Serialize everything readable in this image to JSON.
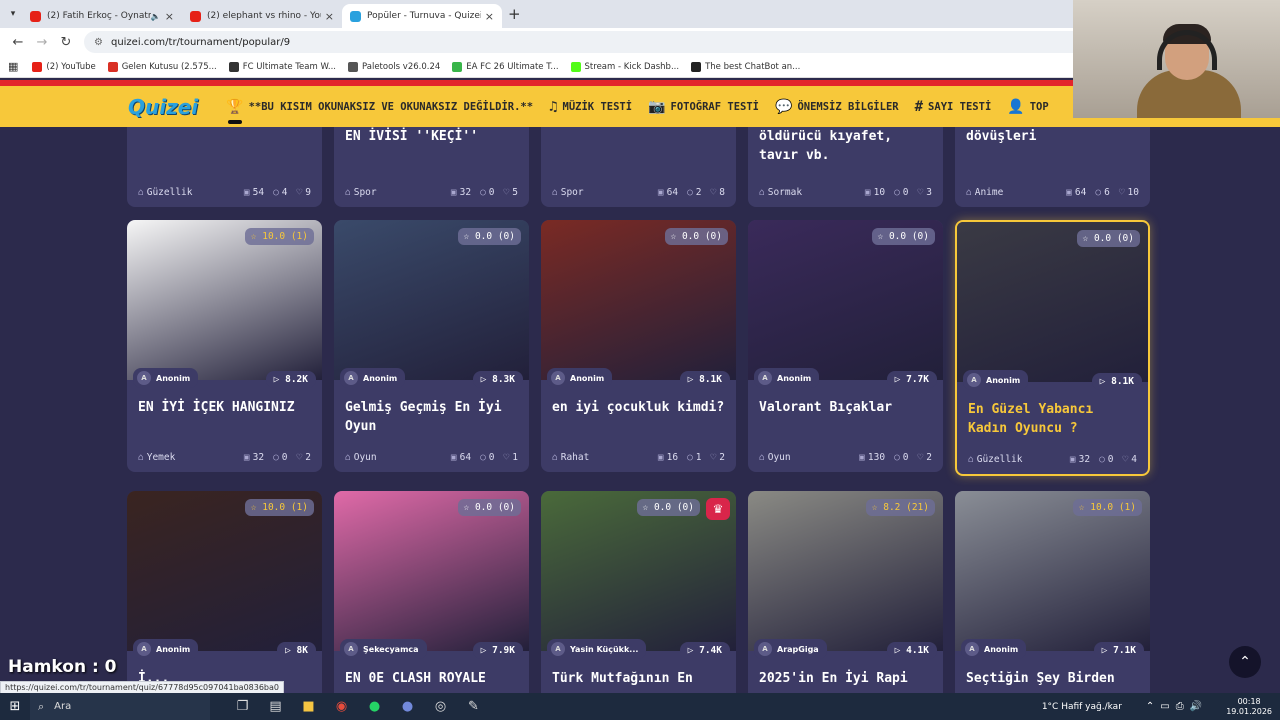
{
  "browser": {
    "tabs": [
      {
        "title": "(2) Fatih Erkoç - Oynatmay",
        "color": "#e62117",
        "muted": true,
        "active": false
      },
      {
        "title": "(2) elephant vs rhino - YouTube",
        "color": "#e62117",
        "muted": false,
        "active": false
      },
      {
        "title": "Popüler - Turnuva - Quizei",
        "color": "#2aa1de",
        "muted": false,
        "active": true
      }
    ],
    "new_tab": "+",
    "url": "quizei.com/tr/tournament/popular/9",
    "bookmarks": [
      {
        "label": "(2) YouTube",
        "color": "#e62117"
      },
      {
        "label": "Gelen Kutusu (2.575...",
        "color": "#d93025"
      },
      {
        "label": "FC Ultimate Team W...",
        "color": "#333333"
      },
      {
        "label": "Paletools v26.0.24",
        "color": "#555555"
      },
      {
        "label": "EA FC 26 Ultimate T...",
        "color": "#39b54a"
      },
      {
        "label": "Stream - Kick Dashb...",
        "color": "#53fc18"
      },
      {
        "label": "The best ChatBot an...",
        "color": "#222222"
      }
    ]
  },
  "site": {
    "logo": "Quizei",
    "nav": [
      {
        "label": "**BU KISIM OKUNAKSIZ VE OKUNAKSIZ DEĞİLDİR.**",
        "icon": "trophy-icon",
        "glyph": "🏆"
      },
      {
        "label": "MÜZİK TESTİ",
        "icon": "music-icon",
        "glyph": "♫"
      },
      {
        "label": "FOTOĞRAF TESTİ",
        "icon": "camera-icon",
        "glyph": "📷"
      },
      {
        "label": "ÖNEMSİZ BİLGİLER",
        "icon": "speech-bubble-icon",
        "glyph": "💬"
      },
      {
        "label": "SAYI TESTİ",
        "icon": "hashtag-icon",
        "glyph": "#"
      },
      {
        "label": "TOP",
        "icon": "user-icon",
        "glyph": "👤"
      }
    ]
  },
  "top_row": [
    {
      "title": "",
      "category": "Güzellik",
      "questions": "54",
      "comments": "4",
      "likes": "9"
    },
    {
      "title": "EN İVİSİ ''KEÇİ''",
      "category": "Spor",
      "questions": "32",
      "comments": "0",
      "likes": "5"
    },
    {
      "title": "",
      "category": "Spor",
      "questions": "64",
      "comments": "2",
      "likes": "8"
    },
    {
      "title": "öldürücü kıyafet, tavır vb.",
      "category": "Sormak",
      "questions": "10",
      "comments": "0",
      "likes": "3"
    },
    {
      "title": "dövüşleri",
      "category": "Anime",
      "questions": "64",
      "comments": "6",
      "likes": "10"
    }
  ],
  "row2": [
    {
      "rating": "10.0 (1)",
      "gold": true,
      "author": "Anonim",
      "plays": "8.2K",
      "title": "EN İYİ İÇEK HANGINIZ",
      "category": "Yemek",
      "questions": "32",
      "comments": "0",
      "likes": "2",
      "highlight": false
    },
    {
      "rating": "0.0 (0)",
      "gold": false,
      "author": "Anonim",
      "plays": "8.3K",
      "title": "Gelmiş Geçmiş En İyi Oyun",
      "category": "Oyun",
      "questions": "64",
      "comments": "0",
      "likes": "1",
      "highlight": false
    },
    {
      "rating": "0.0 (0)",
      "gold": false,
      "author": "Anonim",
      "plays": "8.1K",
      "title": "en iyi çocukluk kimdi?",
      "category": "Rahat",
      "questions": "16",
      "comments": "1",
      "likes": "2",
      "highlight": false
    },
    {
      "rating": "0.0 (0)",
      "gold": false,
      "author": "Anonim",
      "plays": "7.7K",
      "title": "Valorant Bıçaklar",
      "category": "Oyun",
      "questions": "130",
      "comments": "0",
      "likes": "2",
      "highlight": false
    },
    {
      "rating": "0.0 (0)",
      "gold": false,
      "author": "Anonim",
      "plays": "8.1K",
      "title": "En Güzel Yabancı Kadın Oyuncu ?",
      "category": "Güzellik",
      "questions": "32",
      "comments": "0",
      "likes": "4",
      "highlight": true
    }
  ],
  "row3": [
    {
      "rating": "10.0 (1)",
      "gold": true,
      "author": "Anonim",
      "plays": "8K",
      "title": "İ...",
      "crown": false
    },
    {
      "rating": "0.0 (0)",
      "gold": false,
      "author": "Şekecyamca",
      "plays": "7.9K",
      "title": "EN 0E CLASH ROYALE",
      "crown": false
    },
    {
      "rating": "0.0 (0)",
      "gold": false,
      "author": "Yasin Küçükk...",
      "plays": "7.4K",
      "title": "Türk Mutfağının En",
      "crown": true
    },
    {
      "rating": "8.2 (21)",
      "gold": true,
      "author": "ArapGiga",
      "plays": "4.1K",
      "title": "2025'in En İyi Rapi",
      "crown": false
    },
    {
      "rating": "10.0 (1)",
      "gold": true,
      "author": "Anonim",
      "plays": "7.1K",
      "title": "Seçtiğin Şey Birden",
      "crown": false
    }
  ],
  "overlay": {
    "hamkon": "Hamkon : 0",
    "status_url": "https://quizei.com/tr/tournament/quiz/67778d95c097041ba0836ba0"
  },
  "taskbar": {
    "search_label": "Ara",
    "weather": "1°C  Hafif yağ./kar",
    "time": "00:18",
    "date": "19.01.2026"
  }
}
